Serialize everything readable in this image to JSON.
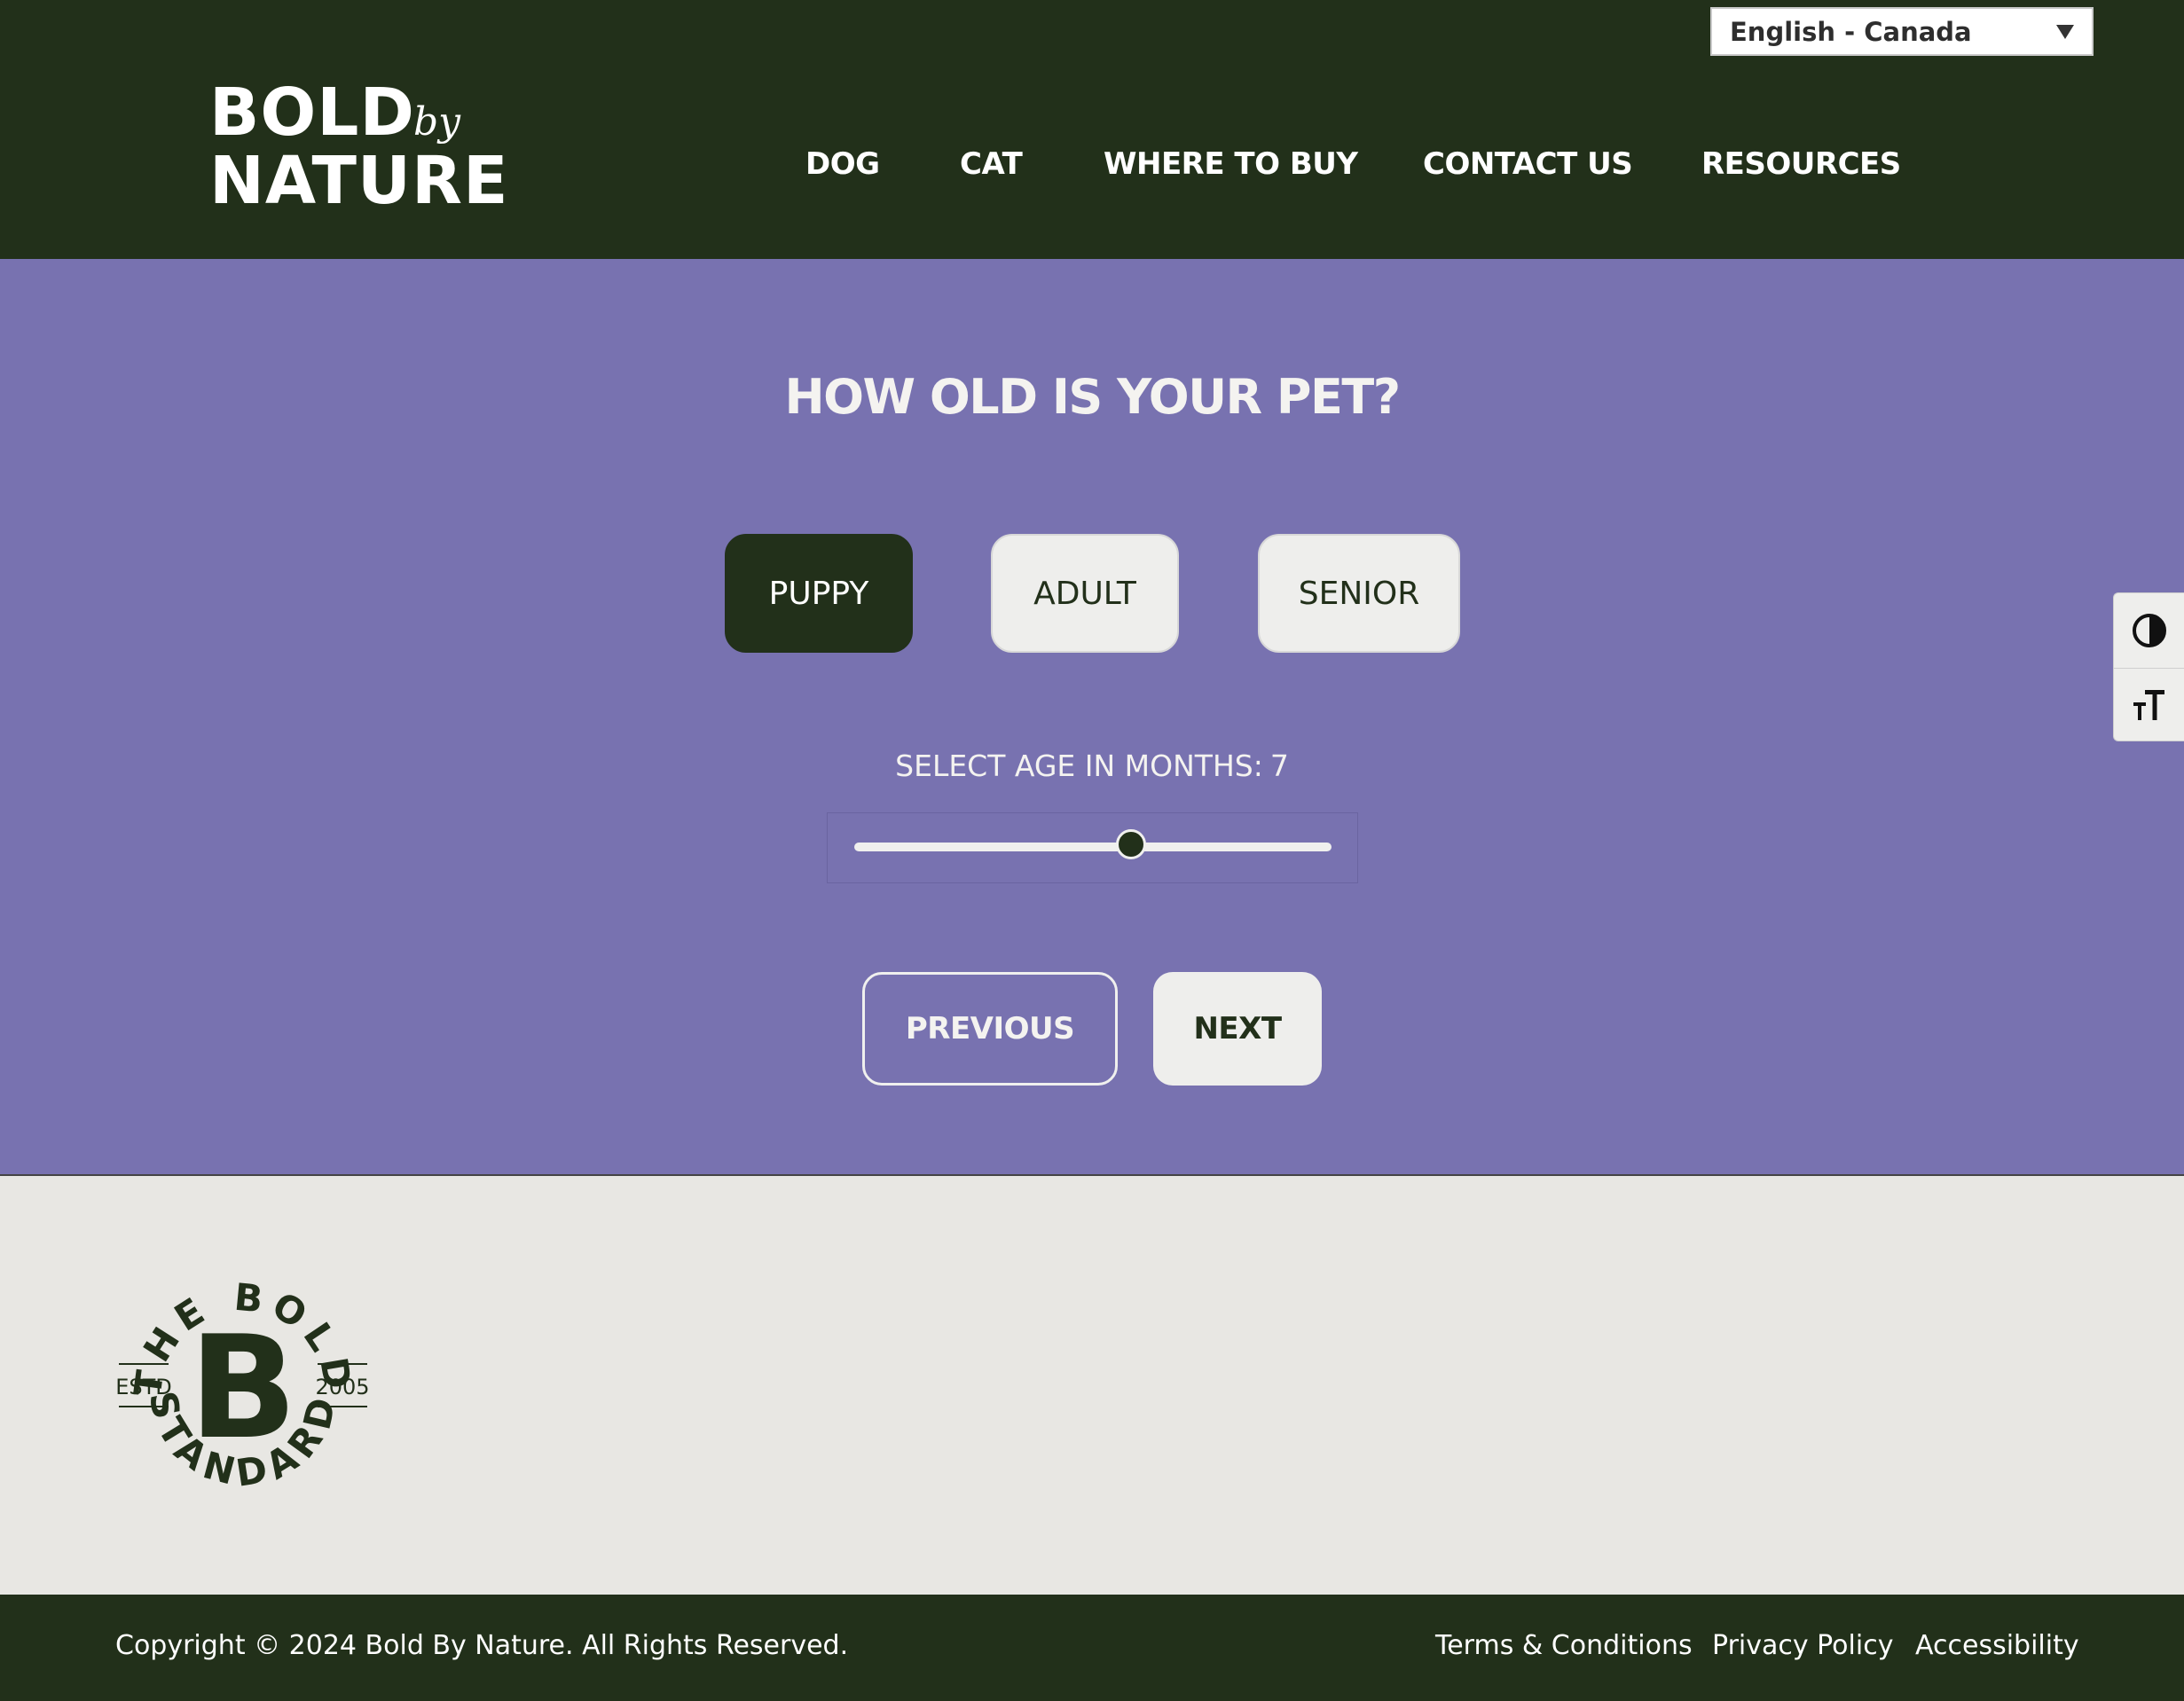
{
  "language_select": {
    "value": "English - Canada"
  },
  "logo": {
    "line1": "BOLD",
    "by": "by",
    "line2": "NATURE"
  },
  "nav": {
    "items": [
      "DOG",
      "CAT",
      "WHERE TO BUY",
      "CONTACT US",
      "RESOURCES"
    ]
  },
  "quiz": {
    "question": "HOW OLD IS YOUR PET?",
    "options": [
      "PUPPY",
      "ADULT",
      "SENIOR"
    ],
    "selected_option": "PUPPY",
    "age_label": "SELECT AGE IN MONTHS:",
    "age_value": "7",
    "slider_fraction": 0.58,
    "previous_label": "PREVIOUS",
    "next_label": "NEXT"
  },
  "accessibility_toolbar": {
    "icons": [
      "contrast-icon",
      "text-size-icon"
    ]
  },
  "badge": {
    "top_text": "THE BOLD",
    "bottom_text": "STANDARD",
    "left_text": "ESTD",
    "right_text": "2005",
    "letter": "B"
  },
  "footer": {
    "copyright": "Copyright © 2024 Bold By Nature. All Rights Reserved.",
    "links": [
      "Terms & Conditions",
      "Privacy Policy",
      "Accessibility"
    ]
  },
  "colors": {
    "dark_green": "#22301a",
    "purple": "#7872b0",
    "light_gray": "#eeeeec",
    "footer_bg": "#e8e7e3"
  }
}
